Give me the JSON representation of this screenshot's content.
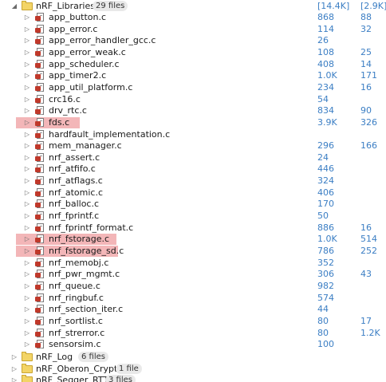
{
  "library_folder": {
    "name": "nRF_Libraries",
    "count": "29 files",
    "size1": "[14.4K]",
    "size2": "[2.9K]",
    "files": [
      {
        "name": "app_button.c",
        "size1": "868",
        "size2": "88",
        "highlighted": false
      },
      {
        "name": "app_error.c",
        "size1": "114",
        "size2": "32",
        "highlighted": false
      },
      {
        "name": "app_error_handler_gcc.c",
        "size1": "26",
        "size2": "",
        "highlighted": false
      },
      {
        "name": "app_error_weak.c",
        "size1": "108",
        "size2": "25",
        "highlighted": false
      },
      {
        "name": "app_scheduler.c",
        "size1": "408",
        "size2": "14",
        "highlighted": false
      },
      {
        "name": "app_timer2.c",
        "size1": "1.0K",
        "size2": "171",
        "highlighted": false
      },
      {
        "name": "app_util_platform.c",
        "size1": "234",
        "size2": "16",
        "highlighted": false
      },
      {
        "name": "crc16.c",
        "size1": "54",
        "size2": "",
        "highlighted": false
      },
      {
        "name": "drv_rtc.c",
        "size1": "834",
        "size2": "90",
        "highlighted": false
      },
      {
        "name": "fds.c",
        "size1": "3.9K",
        "size2": "326",
        "highlighted": true
      },
      {
        "name": "hardfault_implementation.c",
        "size1": "",
        "size2": "",
        "highlighted": false
      },
      {
        "name": "mem_manager.c",
        "size1": "296",
        "size2": "166",
        "highlighted": false
      },
      {
        "name": "nrf_assert.c",
        "size1": "24",
        "size2": "",
        "highlighted": false
      },
      {
        "name": "nrf_atfifo.c",
        "size1": "446",
        "size2": "",
        "highlighted": false
      },
      {
        "name": "nrf_atflags.c",
        "size1": "324",
        "size2": "",
        "highlighted": false
      },
      {
        "name": "nrf_atomic.c",
        "size1": "406",
        "size2": "",
        "highlighted": false
      },
      {
        "name": "nrf_balloc.c",
        "size1": "170",
        "size2": "",
        "highlighted": false
      },
      {
        "name": "nrf_fprintf.c",
        "size1": "50",
        "size2": "",
        "highlighted": false
      },
      {
        "name": "nrf_fprintf_format.c",
        "size1": "886",
        "size2": "16",
        "highlighted": false
      },
      {
        "name": "nrf_fstorage.c",
        "size1": "1.0K",
        "size2": "514",
        "highlighted": true
      },
      {
        "name": "nrf_fstorage_sd.c",
        "size1": "786",
        "size2": "252",
        "highlighted": true
      },
      {
        "name": "nrf_memobj.c",
        "size1": "352",
        "size2": "",
        "highlighted": false
      },
      {
        "name": "nrf_pwr_mgmt.c",
        "size1": "306",
        "size2": "43",
        "highlighted": false
      },
      {
        "name": "nrf_queue.c",
        "size1": "982",
        "size2": "",
        "highlighted": false
      },
      {
        "name": "nrf_ringbuf.c",
        "size1": "574",
        "size2": "",
        "highlighted": false
      },
      {
        "name": "nrf_section_iter.c",
        "size1": "44",
        "size2": "",
        "highlighted": false
      },
      {
        "name": "nrf_sortlist.c",
        "size1": "80",
        "size2": "17",
        "highlighted": false
      },
      {
        "name": "nrf_strerror.c",
        "size1": "80",
        "size2": "1.2K",
        "highlighted": false
      },
      {
        "name": "sensorsim.c",
        "size1": "100",
        "size2": "",
        "highlighted": false
      }
    ]
  },
  "other_folders": [
    {
      "name": "nRF_Log",
      "count": "6 files"
    },
    {
      "name": "nRF_Oberon_Crypto",
      "count": "1 file"
    },
    {
      "name": "nRF_Segger_RTT",
      "count": "3 files"
    }
  ],
  "colors": {
    "highlight": "#f3b6b8",
    "size_text": "#3b7ec4",
    "folder": "#f3d466"
  },
  "icons": {
    "expanded": "triangle-down",
    "collapsed": "triangle-right",
    "folder": "folder-icon",
    "file": "c-file-icon"
  }
}
